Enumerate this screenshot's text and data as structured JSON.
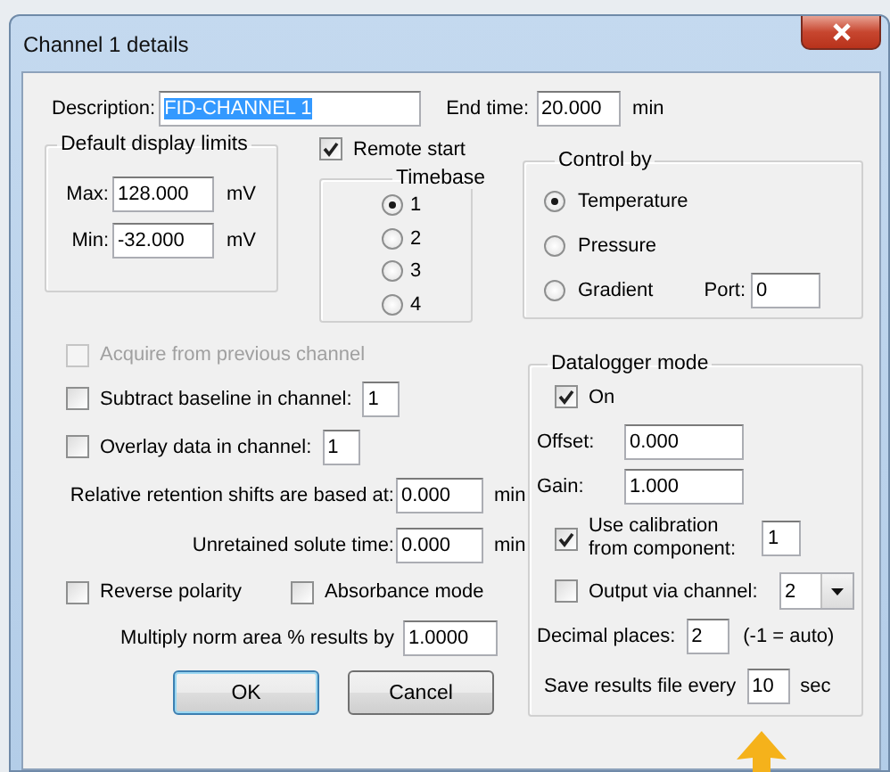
{
  "window": {
    "title": "Channel 1 details"
  },
  "description": {
    "label": "Description:",
    "value": "FID-CHANNEL 1",
    "selected": true
  },
  "end_time": {
    "label": "End time:",
    "value": "20.000",
    "unit": "min"
  },
  "display_limits": {
    "title": "Default display limits",
    "fields": [
      {
        "label": "Max:",
        "value": "128.000",
        "unit": "mV"
      },
      {
        "label": "Min:",
        "value": "-32.000",
        "unit": "mV"
      }
    ]
  },
  "remote_start": {
    "label": "Remote start",
    "checked": true
  },
  "timebase": {
    "title": "Timebase",
    "options": [
      {
        "label": "1",
        "selected": true
      },
      {
        "label": "2",
        "selected": false
      },
      {
        "label": "3",
        "selected": false
      },
      {
        "label": "4",
        "selected": false
      }
    ]
  },
  "control_by": {
    "title": "Control by",
    "options": [
      {
        "label": "Temperature",
        "selected": true
      },
      {
        "label": "Pressure",
        "selected": false
      },
      {
        "label": "Gradient",
        "selected": false
      }
    ],
    "port": {
      "label": "Port:",
      "value": "0"
    }
  },
  "options": [
    {
      "kind": "checkbox",
      "label": "Acquire from previous channel",
      "checked": false,
      "disabled": true
    },
    {
      "kind": "checkbox",
      "label": "Subtract baseline in channel:",
      "checked": false,
      "disabled": false,
      "value": "1"
    },
    {
      "kind": "checkbox",
      "label": "Overlay data in channel:",
      "checked": false,
      "disabled": false,
      "value": "1"
    },
    {
      "kind": "field",
      "label": "Relative retention shifts are based at:",
      "value": "0.000",
      "unit": "min"
    },
    {
      "kind": "field",
      "label": "Unretained solute time:",
      "value": "0.000",
      "unit": "min"
    },
    {
      "kind": "pair",
      "items": [
        {
          "label": "Reverse polarity",
          "checked": false
        },
        {
          "label": "Absorbance mode",
          "checked": false
        }
      ]
    },
    {
      "kind": "field",
      "label": "Multiply norm area % results by",
      "value": "1.0000"
    }
  ],
  "buttons": [
    {
      "label": "OK",
      "default": true
    },
    {
      "label": "Cancel",
      "default": false
    }
  ],
  "datalogger": {
    "title": "Datalogger mode",
    "rows": [
      {
        "kind": "checkbox",
        "label": "On",
        "checked": true
      },
      {
        "kind": "field",
        "label": "Offset:",
        "value": "0.000"
      },
      {
        "kind": "field",
        "label": "Gain:",
        "value": "1.000"
      },
      {
        "kind": "checkbox",
        "label": "Use calibration from component:",
        "checked": true,
        "value": "1"
      },
      {
        "kind": "checkbox",
        "label": "Output via channel:",
        "checked": false,
        "select": "2"
      },
      {
        "kind": "field",
        "label": "Decimal places:",
        "value": "2",
        "note": "(-1 = auto)"
      },
      {
        "kind": "field",
        "label": "Save results file every",
        "value": "10",
        "unit": "sec"
      }
    ]
  }
}
